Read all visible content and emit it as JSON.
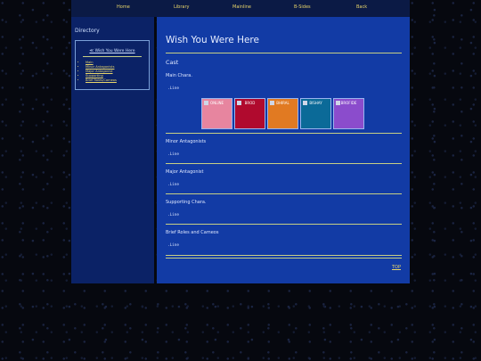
{
  "nav": {
    "items": [
      "Home",
      "Library",
      "Mainline",
      "B-Sides",
      "Back"
    ]
  },
  "sidebar": {
    "title": "Directory",
    "current": "≪ Wish You Were Here",
    "links": [
      "Main",
      "Minor Antagonists",
      "Major Antagonist",
      "Supporting",
      "Brief Roles/Cameos"
    ]
  },
  "main": {
    "title": "Wish You Were Here",
    "cast_label": "Cast",
    "sections": [
      {
        "label": "Main Chara.",
        "line": ".Line"
      },
      {
        "label": "Minor Antagonists",
        "line": ".Line"
      },
      {
        "label": "Major Antagonist",
        "line": ".Line"
      },
      {
        "label": "Supporting Chara.",
        "line": ".Line"
      },
      {
        "label": "Brief Roles and Cameos",
        "line": ".Line"
      }
    ],
    "cards": [
      {
        "label": "ONLINE",
        "color": "#e7859f"
      },
      {
        "label": "BROD",
        "color": "#b00a2e"
      },
      {
        "label": "BHIRAL",
        "color": "#e17a22"
      },
      {
        "label": "BISHAY",
        "color": "#0b6a98"
      },
      {
        "label": "BROFIDE",
        "color": "#8b4ccc"
      }
    ],
    "top_link": "TOP"
  }
}
